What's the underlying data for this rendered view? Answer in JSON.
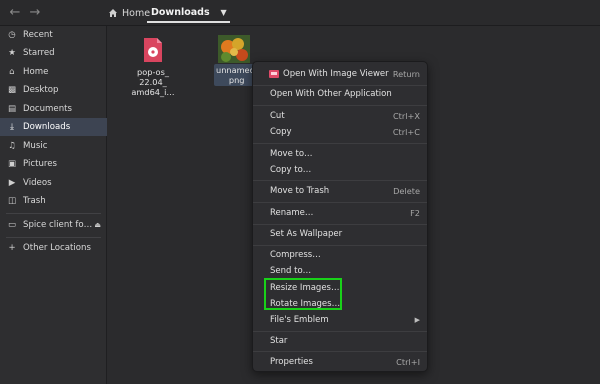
{
  "header": {
    "back_icon": "back-arrow-icon",
    "forward_icon": "forward-arrow-icon",
    "home_label": "Home",
    "current_folder": "Downloads"
  },
  "sidebar": {
    "items": [
      {
        "label": "Recent",
        "icon": "clock-icon"
      },
      {
        "label": "Starred",
        "icon": "star-icon"
      },
      {
        "label": "Home",
        "icon": "home-icon"
      },
      {
        "label": "Desktop",
        "icon": "desktop-icon"
      },
      {
        "label": "Documents",
        "icon": "document-icon"
      },
      {
        "label": "Downloads",
        "icon": "download-icon",
        "active": true
      },
      {
        "label": "Music",
        "icon": "music-icon"
      },
      {
        "label": "Pictures",
        "icon": "pictures-icon"
      },
      {
        "label": "Videos",
        "icon": "video-icon"
      },
      {
        "label": "Trash",
        "icon": "trash-icon"
      }
    ],
    "device": {
      "label": "Spice client fo…",
      "icon": "folder-icon"
    },
    "other_locations": "Other Locations"
  },
  "files": [
    {
      "name_lines": [
        "pop-os_",
        "22.04_",
        "amd64_i…"
      ],
      "icon": "iso-disc-icon"
    },
    {
      "name_lines": [
        "unnamed.",
        "png"
      ],
      "icon": "image-thumbnail-icon",
      "selected": true
    }
  ],
  "context_menu": {
    "items": [
      {
        "label": "Open With Image Viewer",
        "accel": "Return",
        "icon": "image-viewer-icon"
      },
      {
        "label": "Open With Other Application"
      },
      {
        "label": "Cut",
        "accel": "Ctrl+X"
      },
      {
        "label": "Copy",
        "accel": "Ctrl+C"
      },
      {
        "label": "Move to…"
      },
      {
        "label": "Copy to…"
      },
      {
        "label": "Move to Trash",
        "accel": "Delete"
      },
      {
        "label": "Rename…",
        "accel": "F2"
      },
      {
        "label": "Set As Wallpaper"
      },
      {
        "label": "Compress…"
      },
      {
        "label": "Send to…"
      },
      {
        "label": "Resize Images…"
      },
      {
        "label": "Rotate Images…"
      },
      {
        "label": "File's Emblem",
        "submenu": true
      },
      {
        "label": "Star"
      },
      {
        "label": "Properties",
        "accel": "Ctrl+I"
      }
    ]
  },
  "highlight_color": "#19d119",
  "accent_color": "#3d4452"
}
